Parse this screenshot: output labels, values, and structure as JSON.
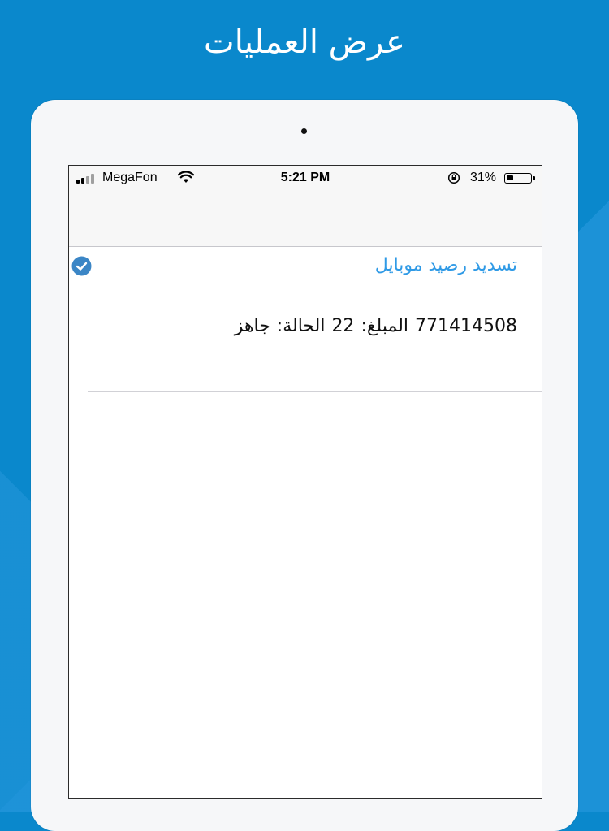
{
  "promo": {
    "title": "عرض العمليات"
  },
  "status_bar": {
    "carrier": "MegaFon",
    "time": "5:21 PM",
    "battery_percent": "31%",
    "battery_level": 0.31,
    "signal_bars_filled": 2,
    "signal_bars_total": 4
  },
  "transactions": [
    {
      "title": "تسديد رصيد موبايل",
      "number": "771414508",
      "amount_label": "المبلغ:",
      "amount": "22",
      "status_label": "الحالة:",
      "status": "جاهز",
      "icon": "checkmark-circle-icon"
    }
  ],
  "colors": {
    "background": "#0a88cc",
    "accent": "#2f9ae6",
    "check_icon": "#3b86c6"
  }
}
